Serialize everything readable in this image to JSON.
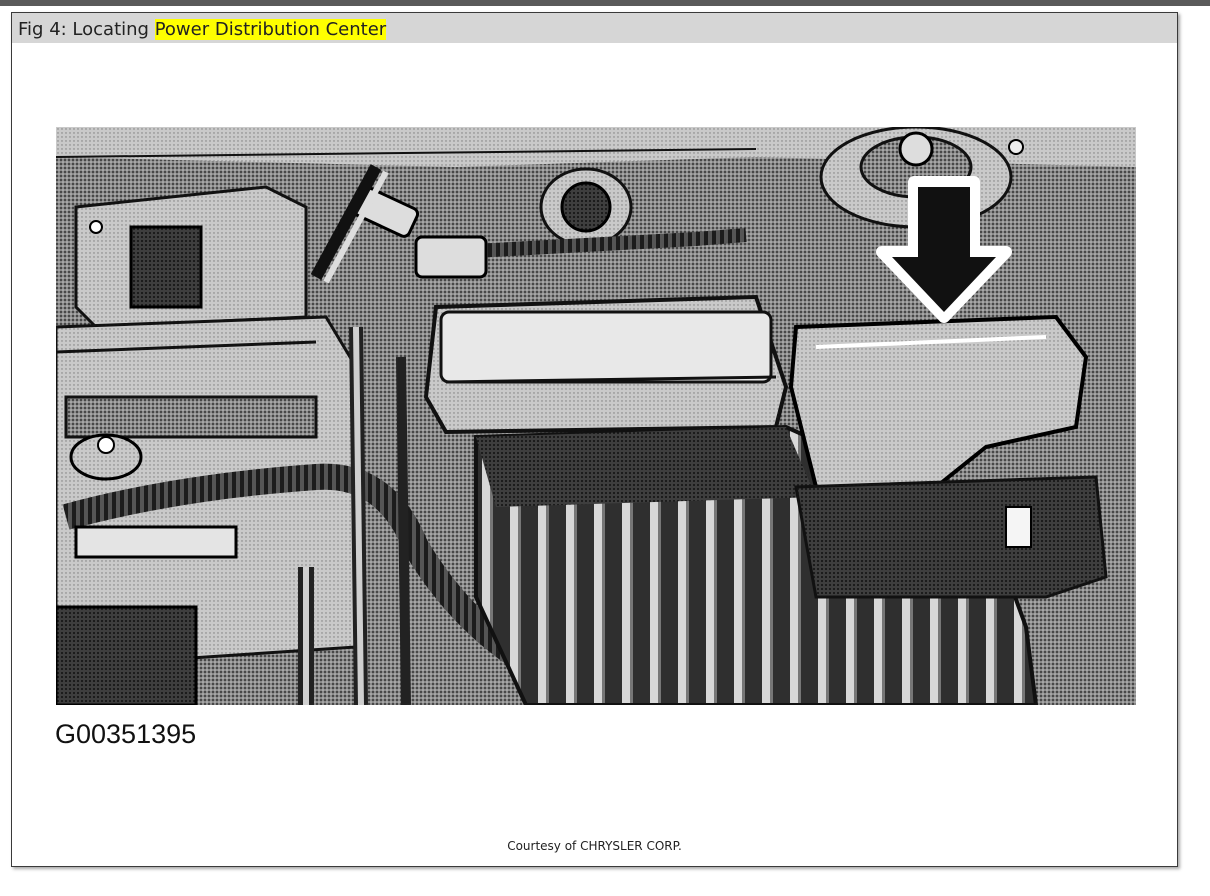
{
  "caption": {
    "prefix": "Fig 4: Locating ",
    "highlight": "Power Distribution Center"
  },
  "figure": {
    "code": "G00351395",
    "subject": "engine-compartment-illustration",
    "pointer": "down-arrow-icon"
  },
  "credit": "Courtesy of CHRYSLER CORP.",
  "colors": {
    "caption_bar": "#d6d6d6",
    "highlight": "#ffff00",
    "top_bar": "#5a5a5a"
  }
}
